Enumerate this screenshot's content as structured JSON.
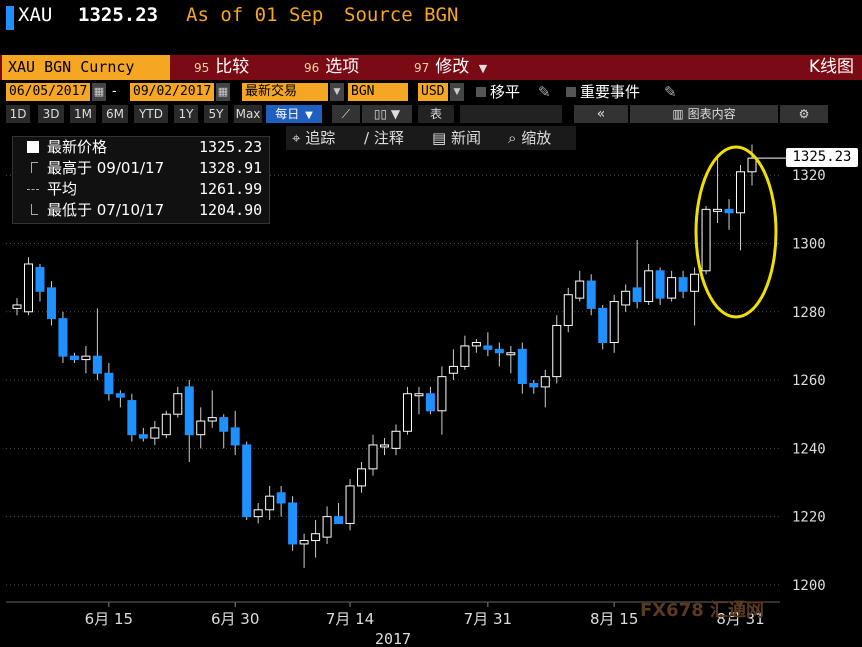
{
  "header": {
    "ticker": "XAU",
    "last_price": "1325.23",
    "as_of": "As of 01 Sep",
    "source": "Source BGN"
  },
  "function_bar": {
    "security": "XAU BGN Curncy",
    "items": [
      {
        "num": "95",
        "label": "比较"
      },
      {
        "num": "96",
        "label": "选项"
      },
      {
        "num": "97",
        "label": "修改"
      }
    ],
    "title": "K线图"
  },
  "options": {
    "start_date": "06/05/2017",
    "dash": "-",
    "end_date": "09/02/2017",
    "price_field": "最新交易",
    "source": "BGN",
    "currency": "USD",
    "move_label": "移平",
    "events_label": "重要事件"
  },
  "ranges": {
    "buttons": [
      "1D",
      "3D",
      "1M",
      "6M",
      "YTD",
      "1Y",
      "5Y",
      "Max"
    ],
    "period": "每日",
    "table_label": "表",
    "chart_content_label": "图表内容"
  },
  "tools": [
    {
      "icon": "crosshair-icon",
      "label": "追踪"
    },
    {
      "icon": "pencil-icon",
      "label": "注释"
    },
    {
      "icon": "news-icon",
      "label": "新闻"
    },
    {
      "icon": "zoom-icon",
      "label": "缩放"
    }
  ],
  "legend": {
    "rows": [
      {
        "label": "最新价格",
        "value": "1325.23"
      },
      {
        "label": "最高于 09/01/17",
        "value": "1328.91"
      },
      {
        "label": "平均",
        "value": "1261.99"
      },
      {
        "label": "最低于 07/10/17",
        "value": "1204.90"
      }
    ]
  },
  "last_tag": "1325.23",
  "watermark": "FX678 汇通网",
  "colors": {
    "up": "#ffffff",
    "down": "#1e90ff",
    "accent": "#f5a623",
    "highlight_ellipse": "#f0e000",
    "function_bar": "#7a0a14"
  },
  "chart_data": {
    "type": "candlestick",
    "ylim": [
      1195,
      1335
    ],
    "yticks": [
      1200,
      1220,
      1240,
      1260,
      1280,
      1300,
      1320
    ],
    "xtick_labels": [
      "6月 15",
      "6月 30",
      "7月 14",
      "7月 31",
      "8月 15",
      "8月 31"
    ],
    "year_label": "2017",
    "candles": [
      {
        "o": 1281,
        "h": 1284,
        "l": 1279,
        "c": 1282
      },
      {
        "o": 1280,
        "h": 1296,
        "l": 1279,
        "c": 1294
      },
      {
        "o": 1293,
        "h": 1294,
        "l": 1283,
        "c": 1286
      },
      {
        "o": 1287,
        "h": 1289,
        "l": 1276,
        "c": 1278
      },
      {
        "o": 1278,
        "h": 1280,
        "l": 1265,
        "c": 1267
      },
      {
        "o": 1267,
        "h": 1268,
        "l": 1265,
        "c": 1266
      },
      {
        "o": 1266,
        "h": 1270,
        "l": 1262,
        "c": 1267
      },
      {
        "o": 1267,
        "h": 1281,
        "l": 1260,
        "c": 1262
      },
      {
        "o": 1262,
        "h": 1265,
        "l": 1254,
        "c": 1256
      },
      {
        "o": 1256,
        "h": 1257,
        "l": 1252,
        "c": 1255
      },
      {
        "o": 1254,
        "h": 1256,
        "l": 1242,
        "c": 1244
      },
      {
        "o": 1244,
        "h": 1246,
        "l": 1242,
        "c": 1243
      },
      {
        "o": 1243,
        "h": 1248,
        "l": 1241,
        "c": 1246
      },
      {
        "o": 1244,
        "h": 1251,
        "l": 1243,
        "c": 1250
      },
      {
        "o": 1250,
        "h": 1258,
        "l": 1249,
        "c": 1256
      },
      {
        "o": 1258,
        "h": 1260,
        "l": 1236,
        "c": 1244
      },
      {
        "o": 1244,
        "h": 1252,
        "l": 1240,
        "c": 1248
      },
      {
        "o": 1248,
        "h": 1257,
        "l": 1246,
        "c": 1249
      },
      {
        "o": 1249,
        "h": 1250,
        "l": 1240,
        "c": 1245
      },
      {
        "o": 1246,
        "h": 1251,
        "l": 1238,
        "c": 1241
      },
      {
        "o": 1241,
        "h": 1242,
        "l": 1219,
        "c": 1220
      },
      {
        "o": 1220,
        "h": 1224,
        "l": 1218,
        "c": 1222
      },
      {
        "o": 1222,
        "h": 1229,
        "l": 1219,
        "c": 1226
      },
      {
        "o": 1227,
        "h": 1229,
        "l": 1220,
        "c": 1224
      },
      {
        "o": 1224,
        "h": 1226,
        "l": 1210,
        "c": 1212
      },
      {
        "o": 1212,
        "h": 1215,
        "l": 1205,
        "c": 1213
      },
      {
        "o": 1213,
        "h": 1219,
        "l": 1208,
        "c": 1215
      },
      {
        "o": 1214,
        "h": 1223,
        "l": 1212,
        "c": 1220
      },
      {
        "o": 1220,
        "h": 1224,
        "l": 1218,
        "c": 1218
      },
      {
        "o": 1218,
        "h": 1231,
        "l": 1216,
        "c": 1229
      },
      {
        "o": 1229,
        "h": 1236,
        "l": 1227,
        "c": 1234
      },
      {
        "o": 1234,
        "h": 1244,
        "l": 1232,
        "c": 1241
      },
      {
        "o": 1241,
        "h": 1243,
        "l": 1238,
        "c": 1241
      },
      {
        "o": 1240,
        "h": 1247,
        "l": 1238,
        "c": 1245
      },
      {
        "o": 1245,
        "h": 1258,
        "l": 1244,
        "c": 1256
      },
      {
        "o": 1256,
        "h": 1258,
        "l": 1250,
        "c": 1256
      },
      {
        "o": 1256,
        "h": 1258,
        "l": 1250,
        "c": 1251
      },
      {
        "o": 1251,
        "h": 1264,
        "l": 1244,
        "c": 1261
      },
      {
        "o": 1262,
        "h": 1269,
        "l": 1260,
        "c": 1264
      },
      {
        "o": 1264,
        "h": 1273,
        "l": 1263,
        "c": 1270
      },
      {
        "o": 1270,
        "h": 1272,
        "l": 1268,
        "c": 1271
      },
      {
        "o": 1270,
        "h": 1274,
        "l": 1267,
        "c": 1269
      },
      {
        "o": 1269,
        "h": 1271,
        "l": 1264,
        "c": 1268
      },
      {
        "o": 1268,
        "h": 1270,
        "l": 1262,
        "c": 1268
      },
      {
        "o": 1269,
        "h": 1271,
        "l": 1256,
        "c": 1259
      },
      {
        "o": 1259,
        "h": 1260,
        "l": 1256,
        "c": 1258
      },
      {
        "o": 1258,
        "h": 1263,
        "l": 1252,
        "c": 1261
      },
      {
        "o": 1261,
        "h": 1279,
        "l": 1259,
        "c": 1276
      },
      {
        "o": 1276,
        "h": 1287,
        "l": 1274,
        "c": 1285
      },
      {
        "o": 1284,
        "h": 1292,
        "l": 1283,
        "c": 1289
      },
      {
        "o": 1289,
        "h": 1291,
        "l": 1279,
        "c": 1281
      },
      {
        "o": 1281,
        "h": 1282,
        "l": 1269,
        "c": 1271
      },
      {
        "o": 1271,
        "h": 1285,
        "l": 1268,
        "c": 1283
      },
      {
        "o": 1282,
        "h": 1288,
        "l": 1280,
        "c": 1286
      },
      {
        "o": 1287,
        "h": 1301,
        "l": 1281,
        "c": 1283
      },
      {
        "o": 1283,
        "h": 1294,
        "l": 1282,
        "c": 1292
      },
      {
        "o": 1292,
        "h": 1293,
        "l": 1282,
        "c": 1284
      },
      {
        "o": 1284,
        "h": 1292,
        "l": 1283,
        "c": 1290
      },
      {
        "o": 1290,
        "h": 1292,
        "l": 1284,
        "c": 1286
      },
      {
        "o": 1286,
        "h": 1293,
        "l": 1276,
        "c": 1291
      },
      {
        "o": 1292,
        "h": 1311,
        "l": 1291,
        "c": 1310
      },
      {
        "o": 1310,
        "h": 1326,
        "l": 1306,
        "c": 1310
      },
      {
        "o": 1310,
        "h": 1313,
        "l": 1304,
        "c": 1309
      },
      {
        "o": 1309,
        "h": 1323,
        "l": 1298,
        "c": 1321
      },
      {
        "o": 1321,
        "h": 1329,
        "l": 1317,
        "c": 1325
      }
    ]
  }
}
